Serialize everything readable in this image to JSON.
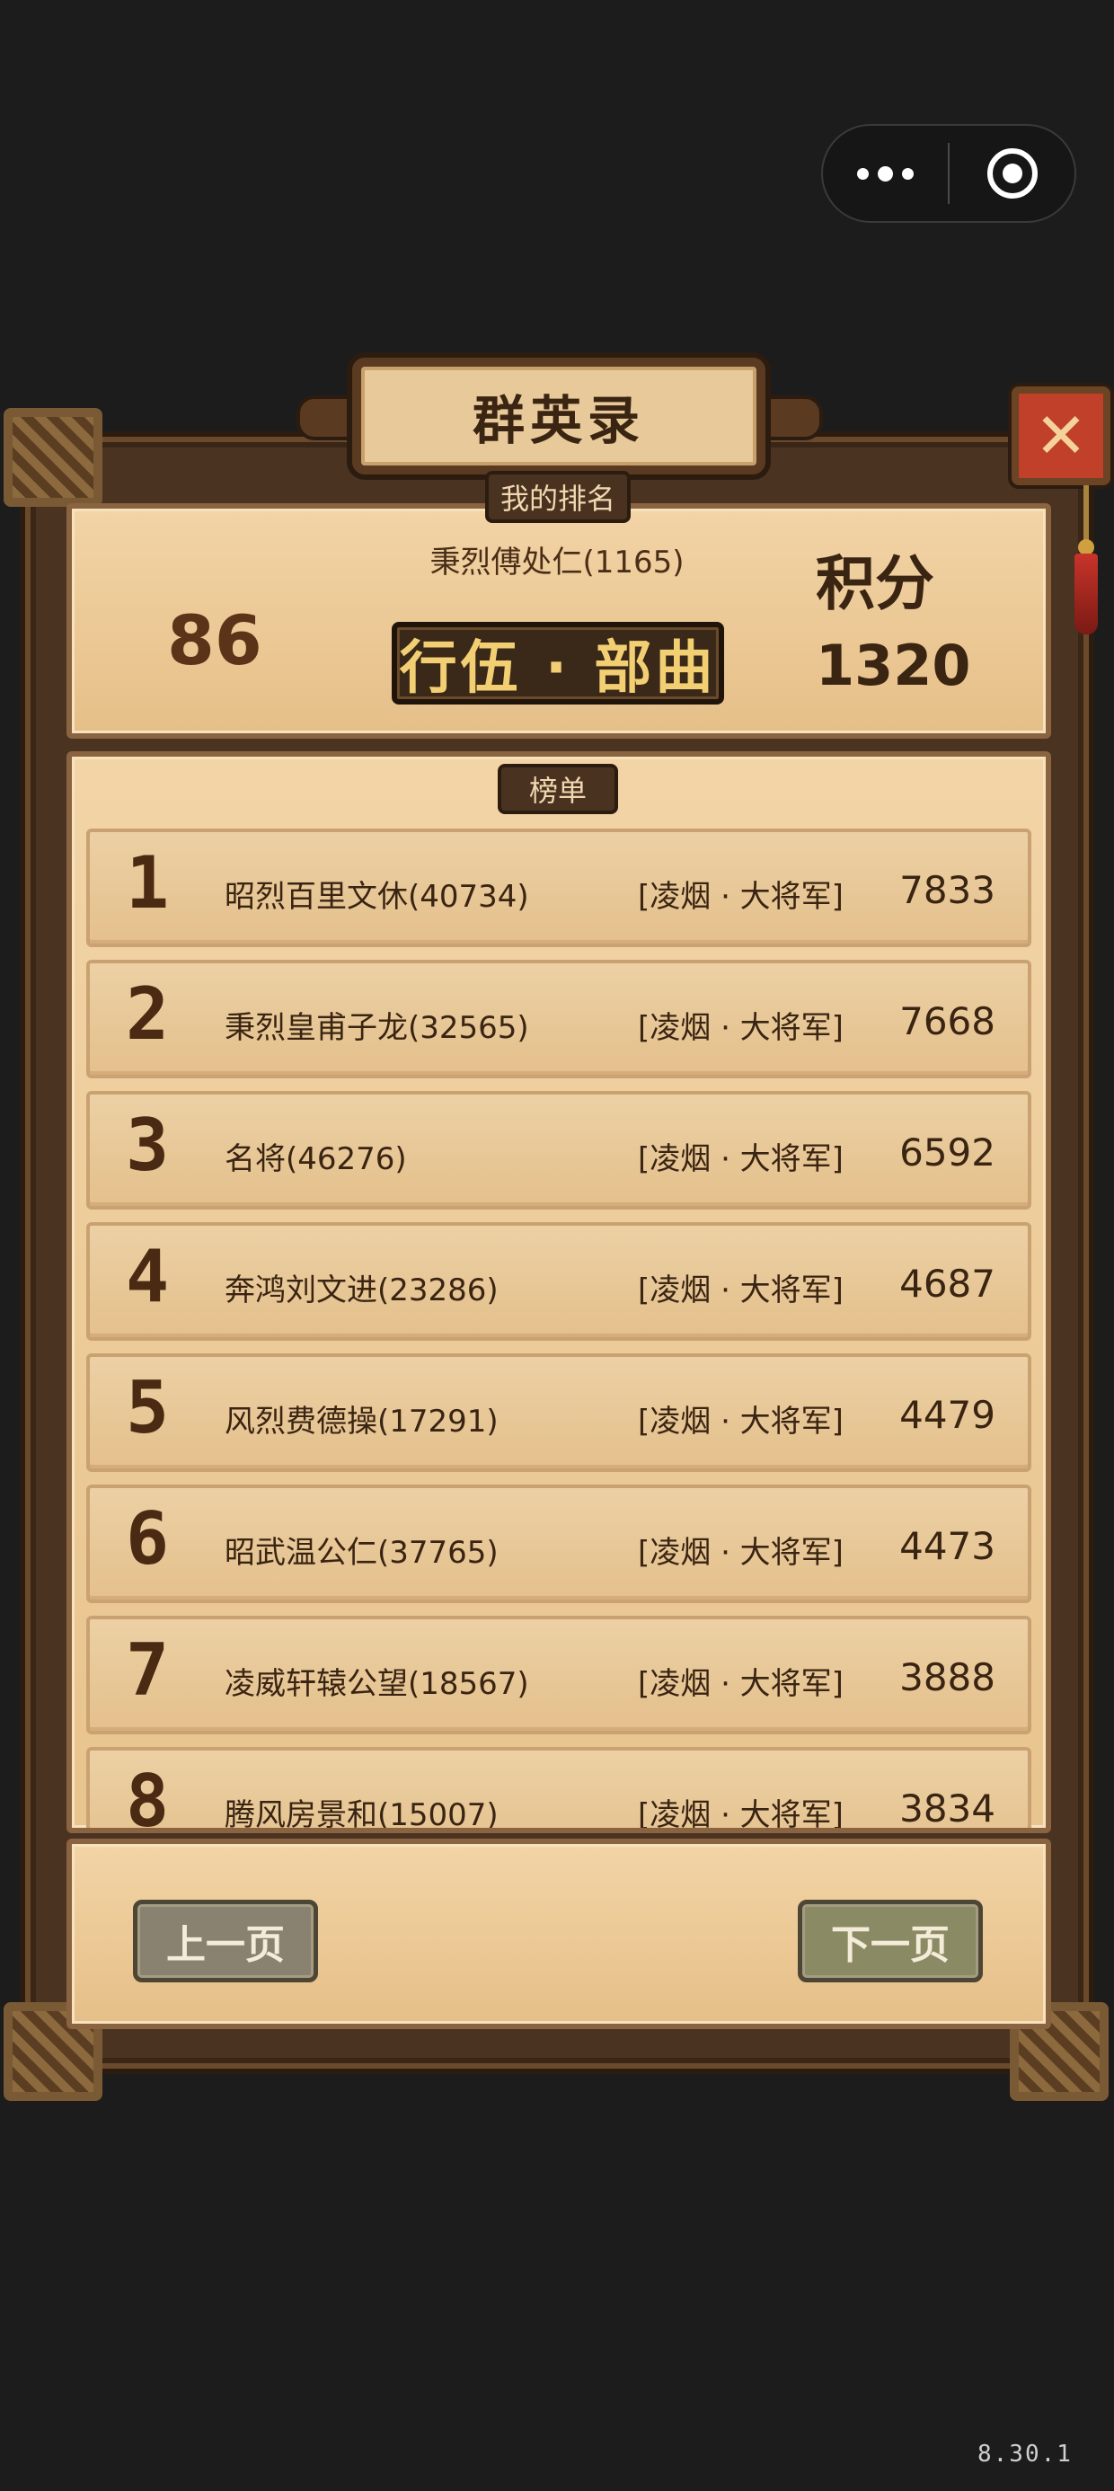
{
  "title": "群英录",
  "close_label": "✕",
  "my_rank": {
    "tag": "我的排名",
    "rank": "86",
    "player": "秉烈傅处仁(1165)",
    "rank_title": "行伍 · 部曲",
    "score_label": "积分",
    "score": "1320"
  },
  "list_tag": "榜单",
  "rows": [
    {
      "rank": "1",
      "name": "昭烈百里文休(40734)",
      "title": "[凌烟 · 大将军]",
      "score": "7833"
    },
    {
      "rank": "2",
      "name": "秉烈皇甫子龙(32565)",
      "title": "[凌烟 · 大将军]",
      "score": "7668"
    },
    {
      "rank": "3",
      "name": "名将(46276)",
      "title": "[凌烟 · 大将军]",
      "score": "6592"
    },
    {
      "rank": "4",
      "name": "奔鸿刘文进(23286)",
      "title": "[凌烟 · 大将军]",
      "score": "4687"
    },
    {
      "rank": "5",
      "name": "风烈费德操(17291)",
      "title": "[凌烟 · 大将军]",
      "score": "4479"
    },
    {
      "rank": "6",
      "name": "昭武温公仁(37765)",
      "title": "[凌烟 · 大将军]",
      "score": "4473"
    },
    {
      "rank": "7",
      "name": "凌威轩辕公望(18567)",
      "title": "[凌烟 · 大将军]",
      "score": "3888"
    },
    {
      "rank": "8",
      "name": "腾风房景和(15007)",
      "title": "[凌烟 · 大将军]",
      "score": "3834"
    }
  ],
  "buttons": {
    "prev": "上一页",
    "next": "下一页"
  },
  "version": "8.30.1"
}
